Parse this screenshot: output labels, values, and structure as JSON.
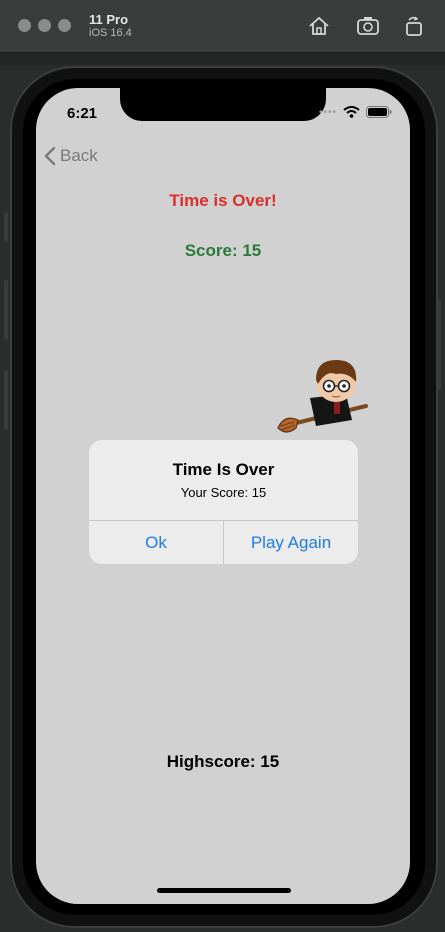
{
  "simulator": {
    "device_name": "11 Pro",
    "os_version": "iOS 16.4",
    "toolbar_icons": [
      "home-icon",
      "screenshot-icon",
      "rotate-icon"
    ]
  },
  "status_bar": {
    "time": "6:21"
  },
  "nav": {
    "back_label": "Back"
  },
  "game": {
    "title": "Time is Over!",
    "score_text": "Score: 15",
    "highscore_text": "Highscore: 15",
    "character": "wizard-on-broom-image"
  },
  "alert": {
    "title": "Time Is Over",
    "message": "Your Score: 15",
    "ok_label": "Ok",
    "play_again_label": "Play Again"
  },
  "colors": {
    "title_red": "#d9302b",
    "score_green": "#2b7a3a",
    "alert_button_blue": "#1e7ce3",
    "screen_background": "#d1d1d1"
  }
}
